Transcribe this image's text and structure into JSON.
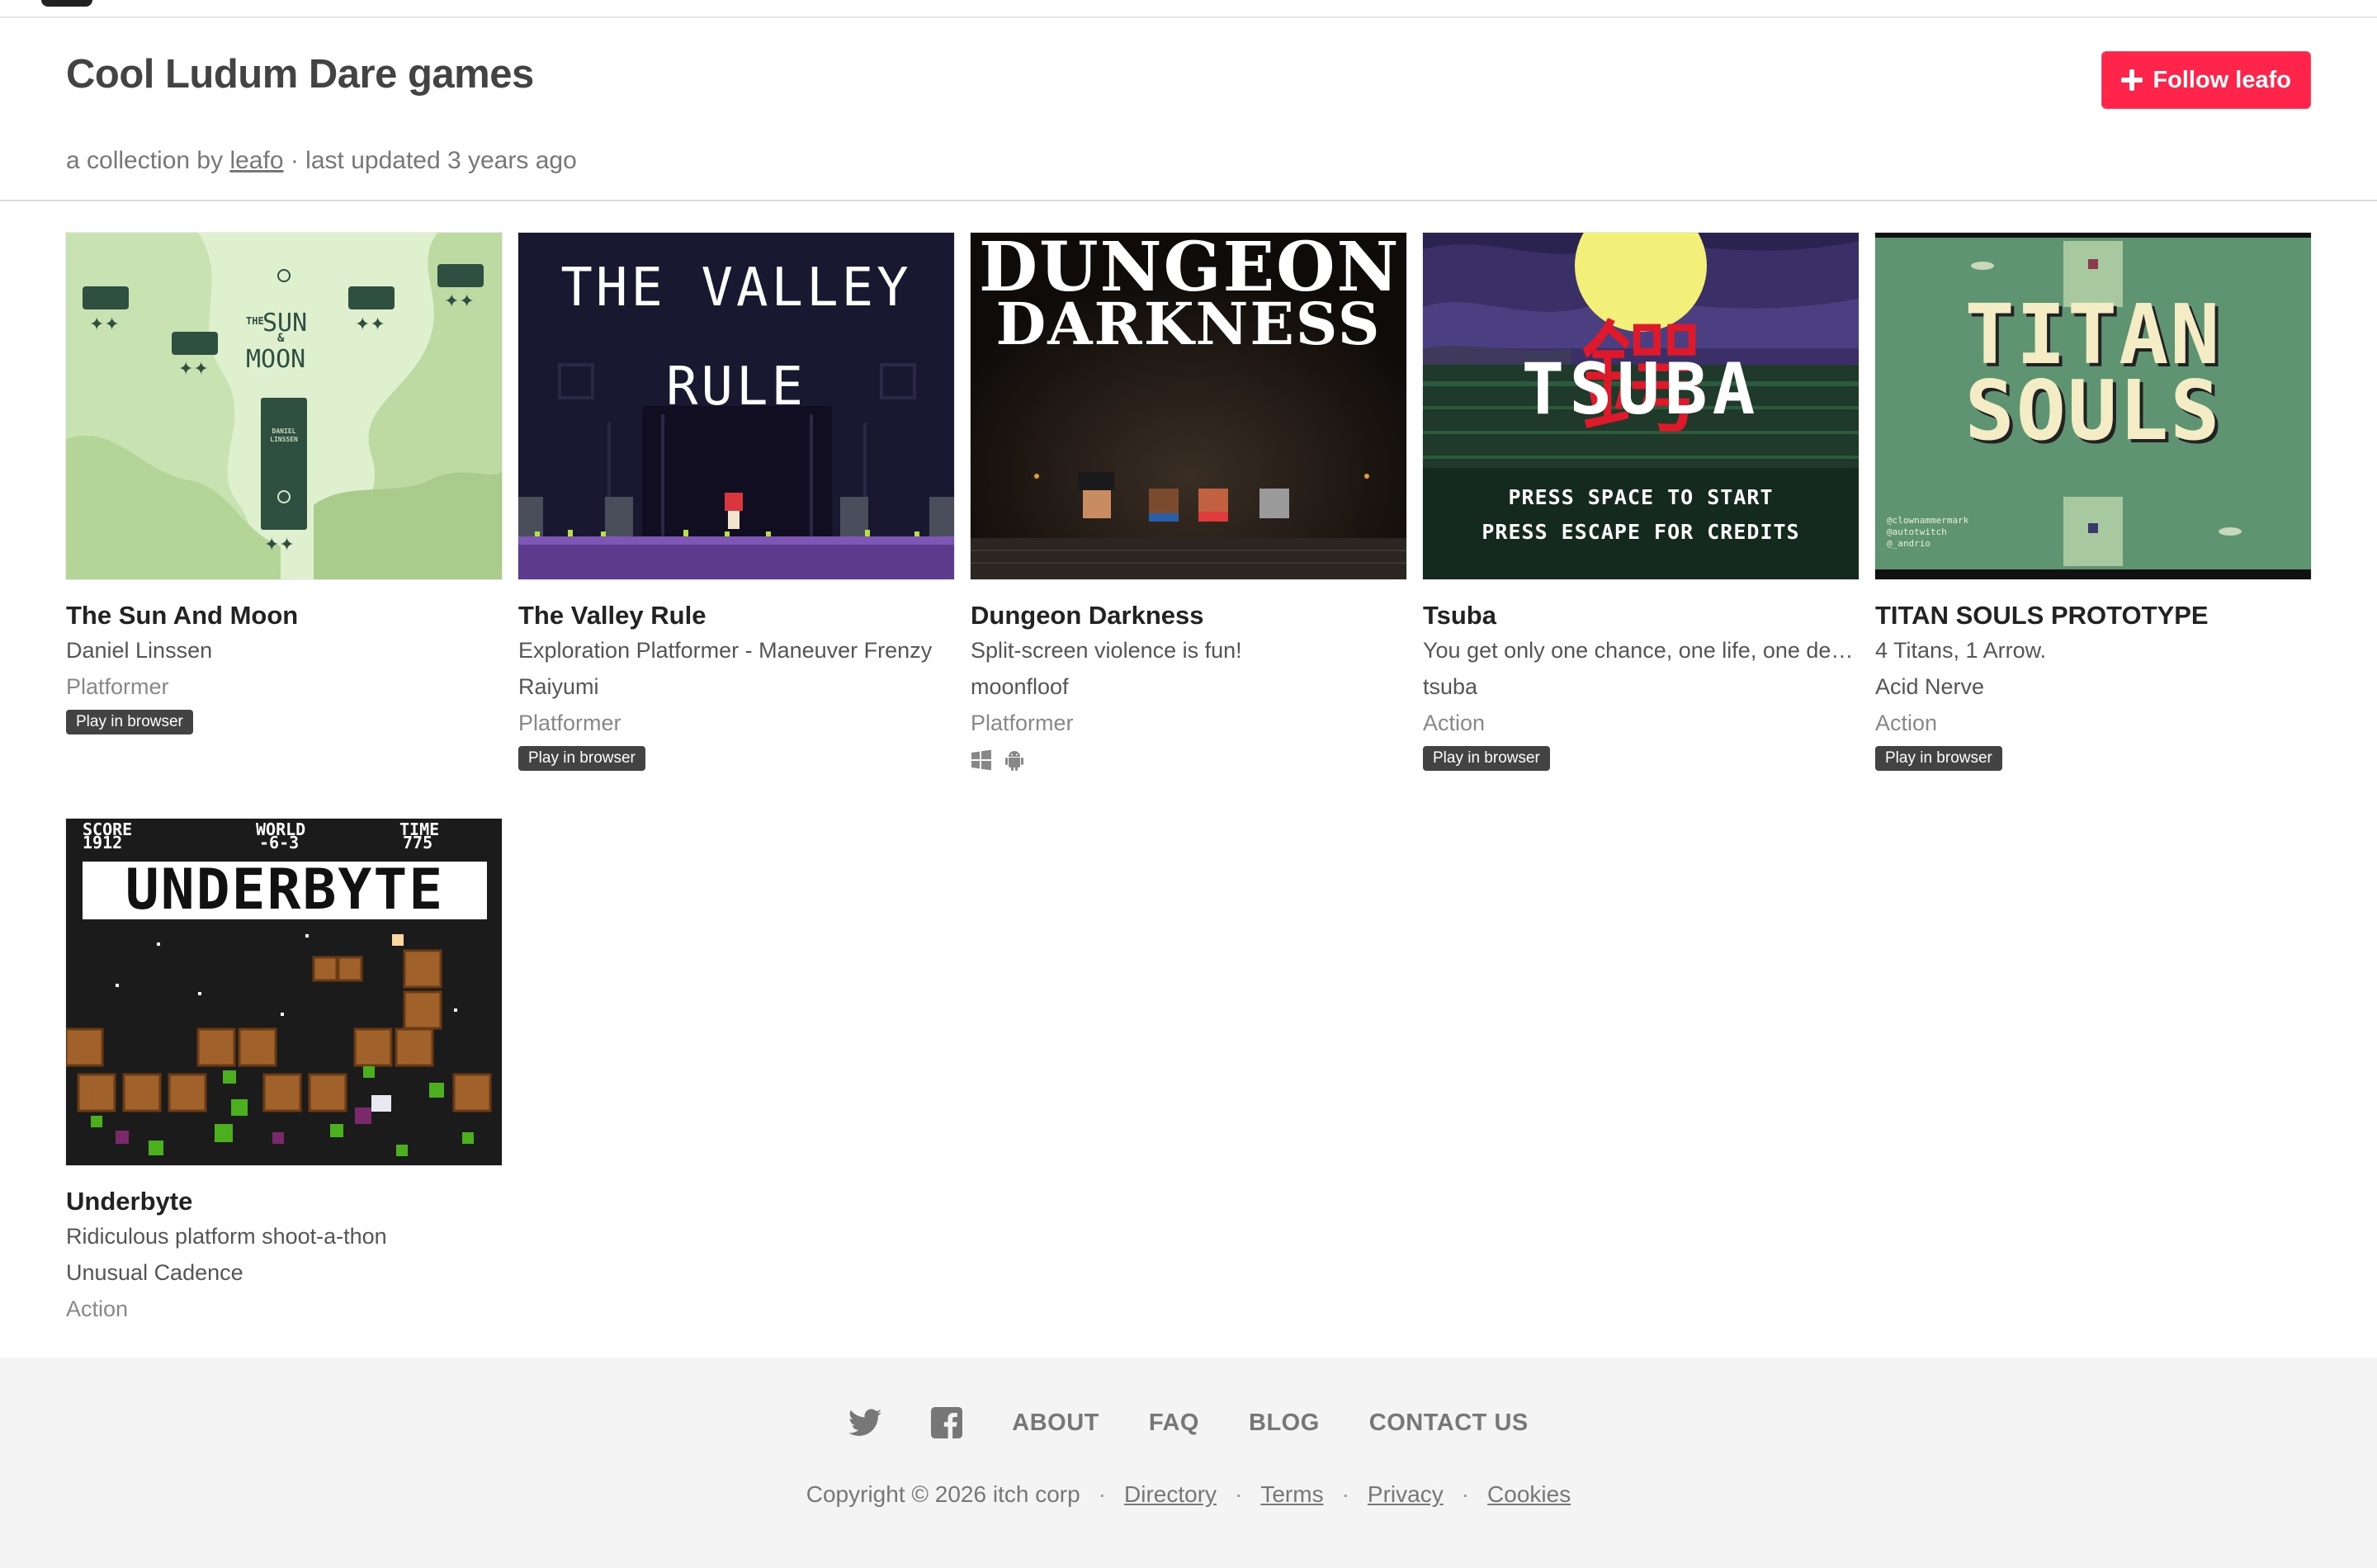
{
  "header": {
    "title": "Cool Ludum Dare games",
    "subtitle_prefix": "a collection by",
    "author": "leafo",
    "subtitle_suffix": "· last updated 3 years ago",
    "follow_label": "Follow leafo"
  },
  "games": [
    {
      "title": "The Sun And Moon",
      "author": "Daniel Linssen",
      "genre": "Platformer",
      "badge": "Play in browser",
      "art_text": [
        "THE",
        "SUN",
        "&",
        "MOON",
        "DANIEL LINSSEN"
      ]
    },
    {
      "title": "The Valley Rule",
      "tagline": "Exploration Platformer - Maneuver Frenzy",
      "author": "Raiyumi",
      "genre": "Platformer",
      "badge": "Play in browser",
      "art_text": [
        "THE VALLEY",
        "RULE"
      ]
    },
    {
      "title": "Dungeon Darkness",
      "tagline": "Split-screen violence is fun!",
      "author": "moonfloof",
      "genre": "Platformer",
      "platforms": [
        "windows-icon",
        "android-icon"
      ],
      "art_text": [
        "DUNGEON",
        "DARKNESS"
      ]
    },
    {
      "title": "Tsuba",
      "tagline": "You get only one chance, one life, one des...",
      "author": "tsuba",
      "genre": "Action",
      "badge": "Play in browser",
      "art_text": [
        "TSUBA",
        "PRESS SPACE TO START",
        "PRESS ESCAPE FOR CREDITS"
      ]
    },
    {
      "title": "TITAN SOULS PROTOTYPE",
      "tagline": "4 Titans, 1 Arrow.",
      "author": "Acid Nerve",
      "genre": "Action",
      "badge": "Play in browser",
      "art_text": [
        "TITAN",
        "SOULS",
        "@clownammermark",
        "@autotwitch",
        "@_andrio"
      ]
    },
    {
      "title": "Underbyte",
      "tagline": "Ridiculous platform shoot-a-thon",
      "author": "Unusual Cadence",
      "genre": "Action",
      "art_text": [
        "SCORE",
        "1912",
        "WORLD",
        "-6-3",
        "TIME",
        "775",
        "UNDERBYTE"
      ]
    }
  ],
  "footer": {
    "nav": [
      "ABOUT",
      "FAQ",
      "BLOG",
      "CONTACT US"
    ],
    "copyright": "Copyright © 2026 itch corp",
    "links": [
      "Directory",
      "Terms",
      "Privacy",
      "Cookies"
    ]
  },
  "colors": {
    "accent": "#ff2449",
    "badge": "#434343",
    "footer_bg": "#f4f4f4"
  }
}
